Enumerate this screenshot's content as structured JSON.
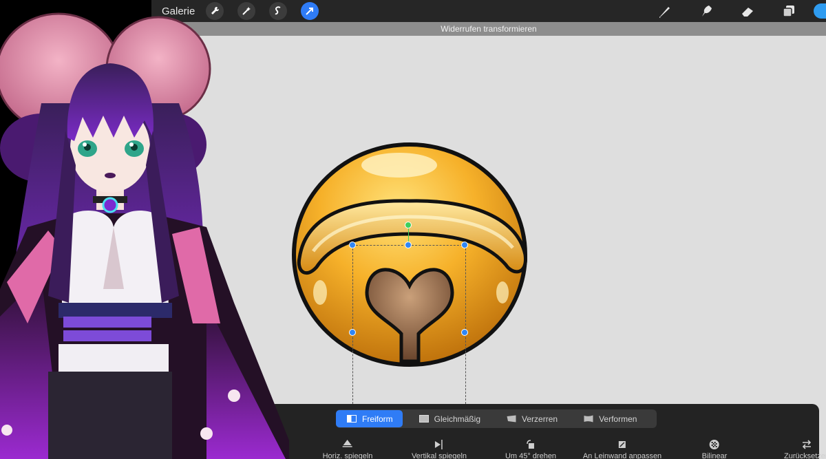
{
  "topbar": {
    "gallery_label": "Galerie",
    "left_tools": [
      {
        "icon": "wrench-icon"
      },
      {
        "icon": "magic-wand-icon"
      },
      {
        "icon": "selection-icon"
      },
      {
        "icon": "transform-arrow-icon",
        "active": true
      }
    ],
    "right_tools": [
      {
        "icon": "brush-icon"
      },
      {
        "icon": "smudge-icon"
      },
      {
        "icon": "eraser-icon"
      },
      {
        "icon": "layers-icon"
      },
      {
        "icon": "color-icon"
      }
    ]
  },
  "notice": "Widerrufen transformieren",
  "transform_panel": {
    "modes": [
      {
        "label": "Freiform",
        "active": true
      },
      {
        "label": "Gleichmäßig"
      },
      {
        "label": "Verzerren"
      },
      {
        "label": "Verformen"
      }
    ],
    "actions": [
      {
        "label": "Horiz. spiegeln",
        "icon": "flip-horizontal-icon"
      },
      {
        "label": "Vertikal spiegeln",
        "icon": "flip-vertical-icon"
      },
      {
        "label": "Um 45° drehen",
        "icon": "rotate-icon"
      },
      {
        "label": "An Leinwand anpassen",
        "icon": "fit-canvas-icon"
      },
      {
        "label": "Bilinear",
        "icon": "interpolation-icon"
      },
      {
        "label": "Zurücksetzen",
        "icon": "reset-icon"
      }
    ]
  },
  "colors": {
    "accent": "#2f7cf6",
    "toolbar": "#262626",
    "canvas": "#dedede",
    "bell_gold": "#f2a91a"
  }
}
